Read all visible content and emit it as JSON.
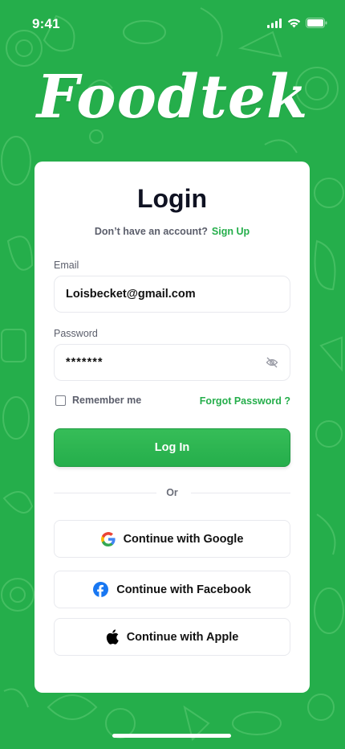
{
  "status": {
    "time": "9:41"
  },
  "app": {
    "name": "Foodtek"
  },
  "login": {
    "title": "Login",
    "signup_prompt": "Don’t have an account?",
    "signup_link": "Sign Up",
    "email_label": "Email",
    "email_value": "Loisbecket@gmail.com",
    "password_label": "Password",
    "password_value": "*******",
    "remember_label": "Remember me",
    "remember_checked": false,
    "forgot_label": "Forgot Password ?",
    "login_button": "Log In",
    "or_text": "Or"
  },
  "social": [
    {
      "label": "Continue with Google",
      "icon": "google-icon"
    },
    {
      "label": "Continue with Facebook",
      "icon": "facebook-icon"
    },
    {
      "label": "Continue with Apple",
      "icon": "apple-icon"
    }
  ],
  "colors": {
    "brand": "#25ae4b",
    "text": "#0f1222",
    "muted": "#5b5e6b"
  }
}
